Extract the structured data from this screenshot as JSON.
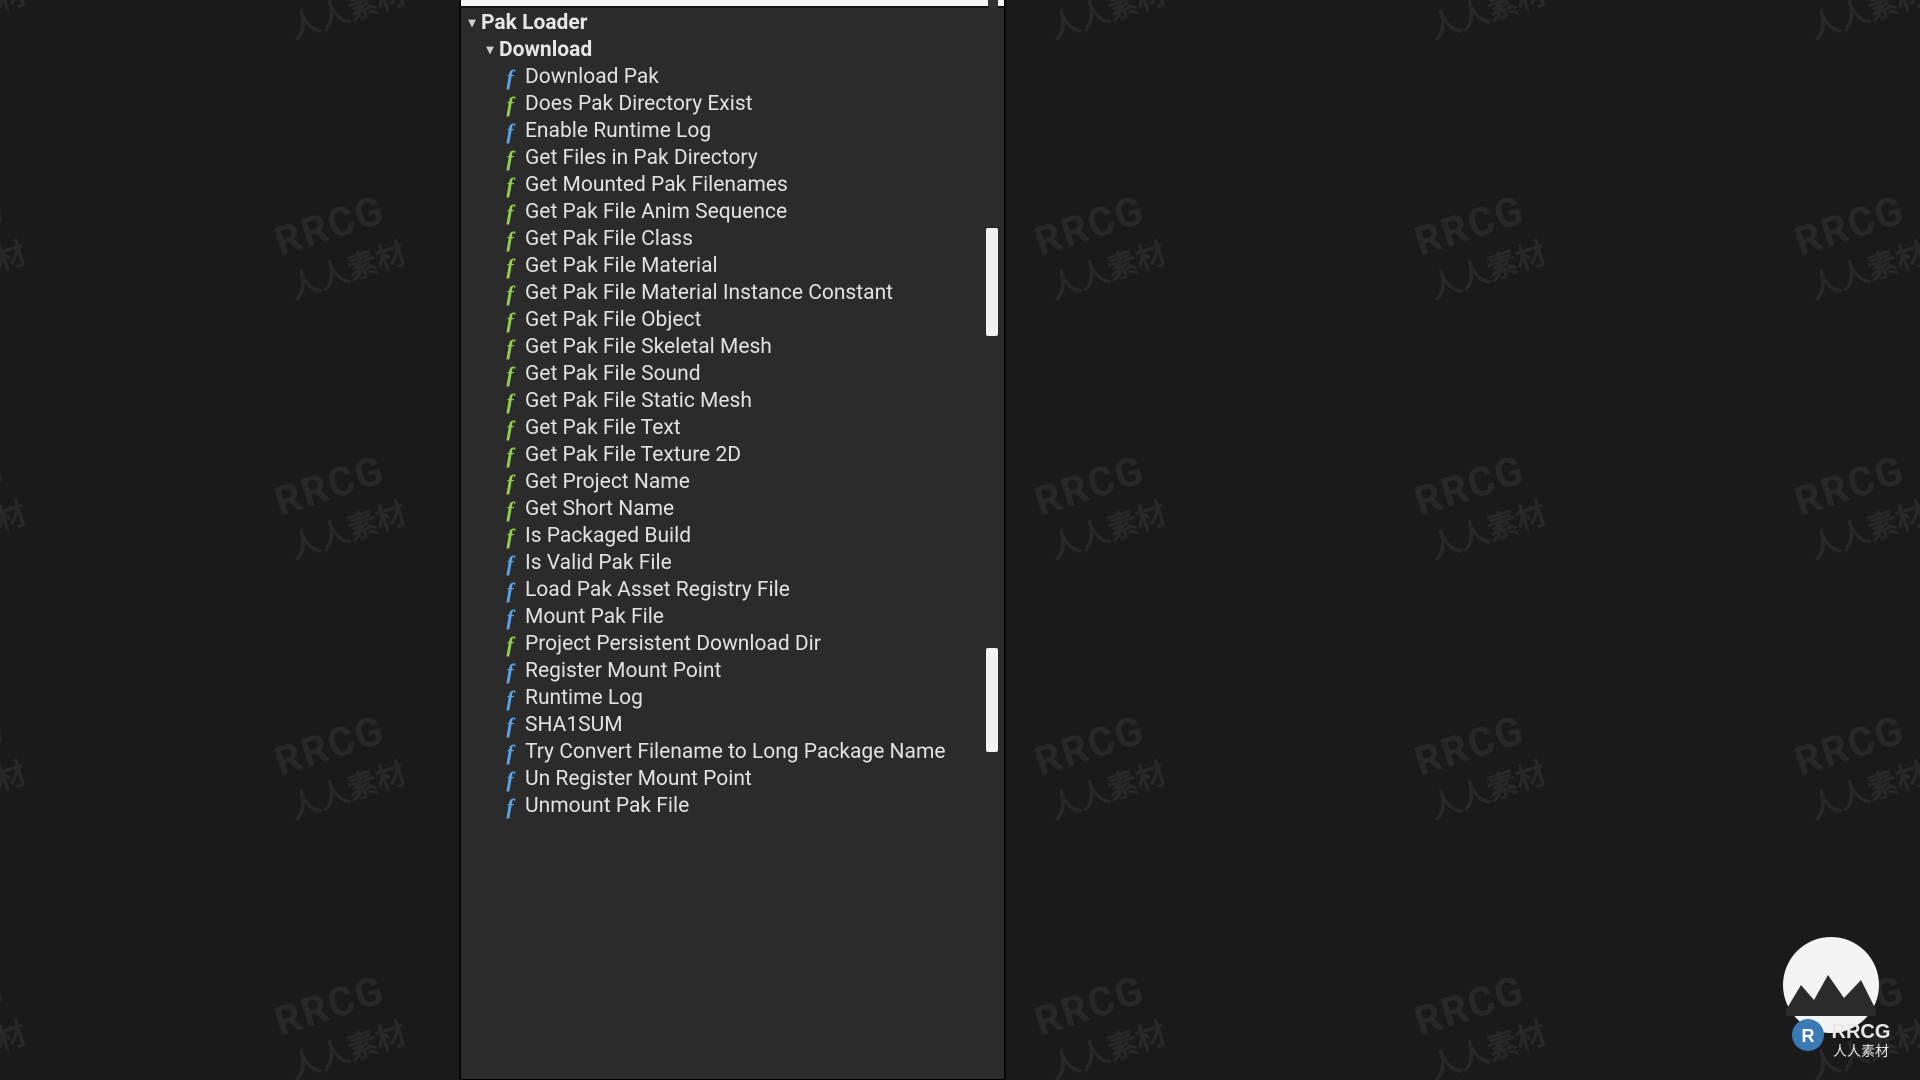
{
  "watermark": {
    "eng": "RRCG",
    "chn": "人人素材"
  },
  "panel": {
    "root_category": "Pak Loader",
    "sub_category": "Download",
    "functions": [
      {
        "label": "Download Pak",
        "color": "blue"
      },
      {
        "label": "Does Pak Directory Exist",
        "color": "green"
      },
      {
        "label": "Enable Runtime Log",
        "color": "blue"
      },
      {
        "label": "Get Files in Pak Directory",
        "color": "green"
      },
      {
        "label": "Get Mounted Pak Filenames",
        "color": "green"
      },
      {
        "label": "Get Pak File Anim Sequence",
        "color": "green"
      },
      {
        "label": "Get Pak File Class",
        "color": "green"
      },
      {
        "label": "Get Pak File Material",
        "color": "green"
      },
      {
        "label": "Get Pak File Material Instance Constant",
        "color": "green"
      },
      {
        "label": "Get Pak File Object",
        "color": "green"
      },
      {
        "label": "Get Pak File Skeletal Mesh",
        "color": "green"
      },
      {
        "label": "Get Pak File Sound",
        "color": "green"
      },
      {
        "label": "Get Pak File Static Mesh",
        "color": "green"
      },
      {
        "label": "Get Pak File Text",
        "color": "green"
      },
      {
        "label": "Get Pak File Texture 2D",
        "color": "green"
      },
      {
        "label": "Get Project Name",
        "color": "green"
      },
      {
        "label": "Get Short Name",
        "color": "green"
      },
      {
        "label": "Is Packaged Build",
        "color": "green"
      },
      {
        "label": "Is Valid Pak File",
        "color": "blue"
      },
      {
        "label": "Load Pak Asset Registry File",
        "color": "blue"
      },
      {
        "label": "Mount Pak File",
        "color": "blue"
      },
      {
        "label": "Project Persistent Download Dir",
        "color": "green"
      },
      {
        "label": "Register Mount Point",
        "color": "blue"
      },
      {
        "label": "Runtime Log",
        "color": "blue"
      },
      {
        "label": "SHA1SUM",
        "color": "blue"
      },
      {
        "label": "Try Convert Filename to Long Package Name",
        "color": "blue"
      },
      {
        "label": "Un Register Mount Point",
        "color": "blue"
      },
      {
        "label": "Unmount Pak File",
        "color": "blue"
      }
    ]
  },
  "logo": {
    "alt": "RRCG 人人素材"
  }
}
